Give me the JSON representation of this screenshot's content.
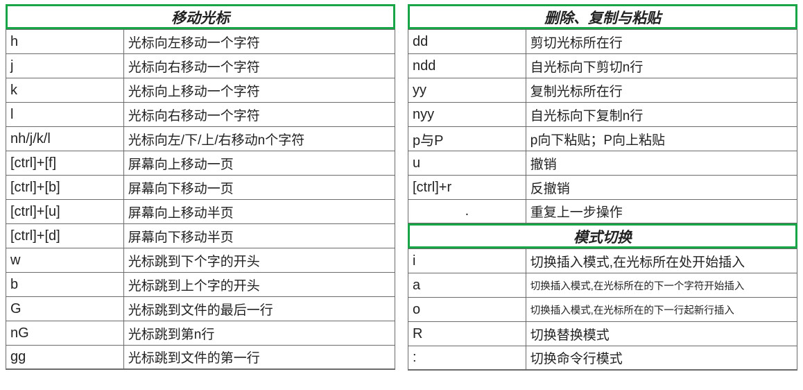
{
  "left": {
    "title": "移动光标",
    "rows": [
      {
        "key": "h",
        "desc": "光标向左移动一个字符"
      },
      {
        "key": "j",
        "desc": "光标向右移动一个字符"
      },
      {
        "key": "k",
        "desc": "光标向上移动一个字符"
      },
      {
        "key": "l",
        "desc": "光标向右移动一个字符"
      },
      {
        "key": "nh/j/k/l",
        "desc": "光标向左/下/上/右移动n个字符"
      },
      {
        "key": "[ctrl]+[f]",
        "desc": "屏幕向上移动一页"
      },
      {
        "key": "[ctrl]+[b]",
        "desc": "屏幕向下移动一页"
      },
      {
        "key": "[ctrl]+[u]",
        "desc": "屏幕向上移动半页"
      },
      {
        "key": "[ctrl]+[d]",
        "desc": "屏幕向下移动半页"
      },
      {
        "key": "w",
        "desc": "光标跳到下个字的开头"
      },
      {
        "key": "b",
        "desc": "光标跳到上个字的开头"
      },
      {
        "key": "G",
        "desc": "光标跳到文件的最后一行"
      },
      {
        "key": "nG",
        "desc": "光标跳到第n行"
      },
      {
        "key": "gg",
        "desc": "光标跳到文件的第一行"
      }
    ]
  },
  "right_a": {
    "title": "删除、复制与粘贴",
    "rows": [
      {
        "key": "dd",
        "desc": "剪切光标所在行"
      },
      {
        "key": "ndd",
        "desc": "自光标向下剪切n行"
      },
      {
        "key": "yy",
        "desc": "复制光标所在行"
      },
      {
        "key": "nyy",
        "desc": "自光标向下复制n行"
      },
      {
        "key": "p与P",
        "desc": "p向下粘贴；P向上粘贴"
      },
      {
        "key": "u",
        "desc": "撤销"
      },
      {
        "key": "[ctrl]+r",
        "desc": "反撤销"
      },
      {
        "key": ".",
        "desc": "重复上一步操作",
        "center": true
      }
    ]
  },
  "right_b": {
    "title": "模式切换",
    "rows": [
      {
        "key": "i",
        "desc": "切换插入模式,在光标所在处开始插入"
      },
      {
        "key": "a",
        "desc": "切换插入模式,在光标所在的下一个字符开始插入",
        "small": true
      },
      {
        "key": "o",
        "desc": "切换插入模式,在光标所在的下一行起新行插入",
        "small": true
      },
      {
        "key": "R",
        "desc": "切换替换模式"
      },
      {
        "key": ":",
        "desc": "切换命令行模式"
      }
    ]
  }
}
